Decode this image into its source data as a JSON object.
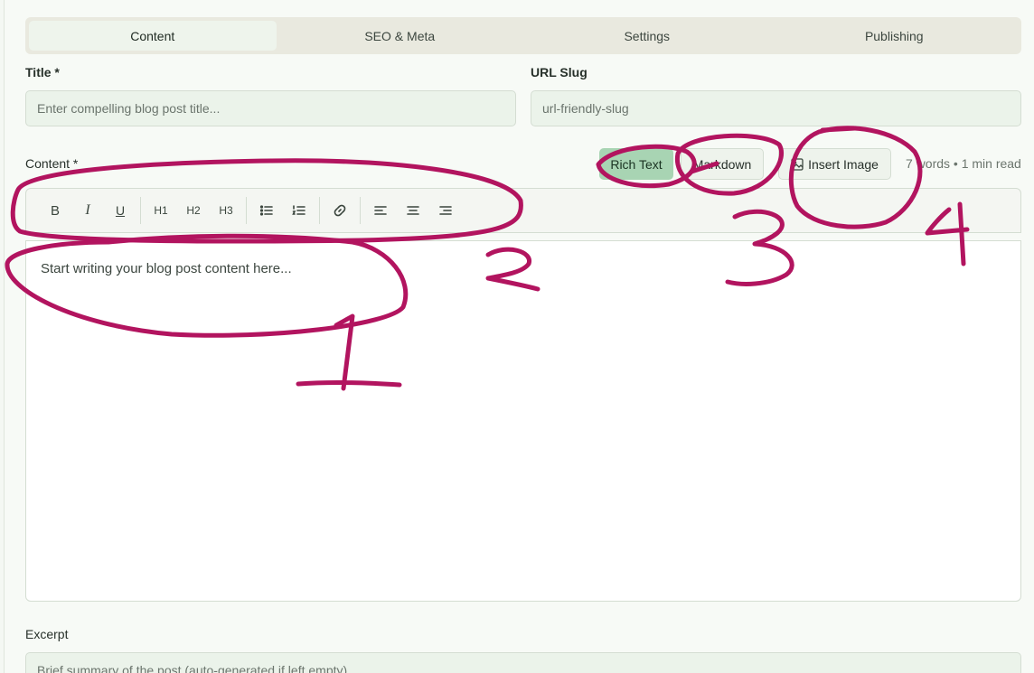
{
  "tabs": [
    {
      "label": "Content",
      "active": true
    },
    {
      "label": "SEO & Meta",
      "active": false
    },
    {
      "label": "Settings",
      "active": false
    },
    {
      "label": "Publishing",
      "active": false
    }
  ],
  "fields": {
    "title_label": "Title *",
    "title_placeholder": "Enter compelling blog post title...",
    "slug_label": "URL Slug",
    "slug_placeholder": "url-friendly-slug",
    "content_label": "Content *",
    "excerpt_label": "Excerpt",
    "excerpt_placeholder": "Brief summary of the post (auto-generated if left empty)..."
  },
  "editor_mode": {
    "rich_text_label": "Rich Text",
    "markdown_label": "Markdown",
    "active": "Rich Text",
    "insert_image_label": "Insert Image",
    "word_count": "7 words • 1 min read"
  },
  "toolbar": {
    "bold": "B",
    "italic": "I",
    "underline": "U",
    "h1": "H1",
    "h2": "H2",
    "h3": "H3",
    "icons": [
      "bullet-list-icon",
      "numbered-list-icon",
      "link-icon",
      "align-left-icon",
      "align-center-icon",
      "align-right-icon"
    ]
  },
  "editor": {
    "placeholder": "Start writing your blog post content here..."
  },
  "annotations": {
    "color": "#b2145f",
    "numbers": [
      "1",
      "2",
      "3",
      "4"
    ]
  },
  "colors": {
    "accent": "#a8d4b3",
    "input_bg": "#ebf3ea",
    "page_bg": "#f4f8f3"
  }
}
